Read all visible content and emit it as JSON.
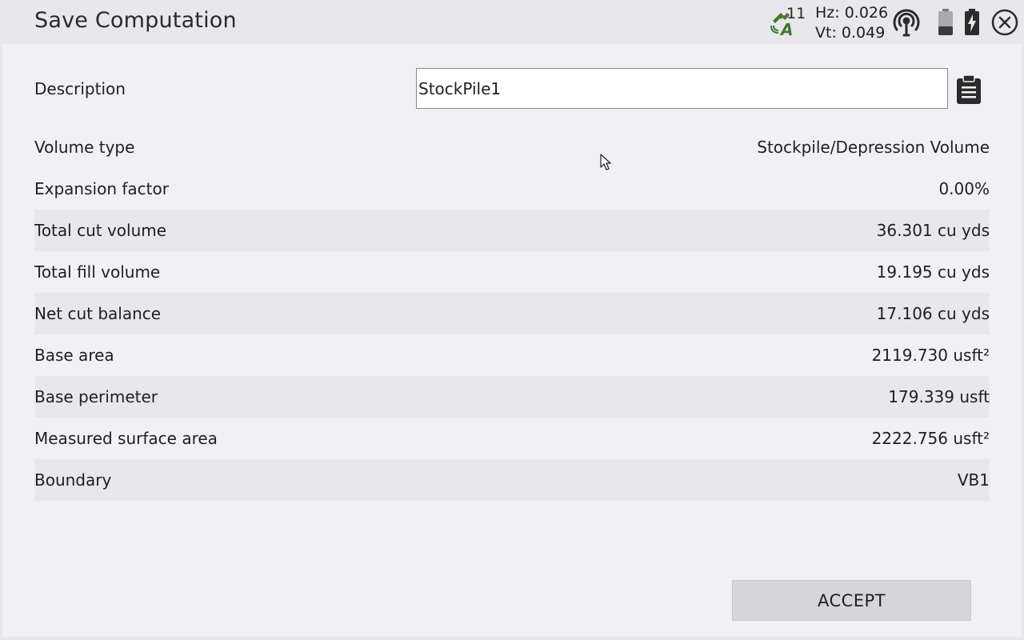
{
  "window": {
    "title": "Save Computation"
  },
  "status": {
    "satellite_icon": "satellite-rtk-icon",
    "satellite_count": "11",
    "hz_precision": "Hz: 0.026",
    "vt_precision": "Vt: 0.049",
    "radio_icon": "radio-signal-icon",
    "battery1_icon": "battery-low-icon",
    "battery2_icon": "battery-charging-icon",
    "close_icon": "close-circle-icon"
  },
  "form": {
    "description_label": "Description",
    "description_value": "StockPile1",
    "clipboard_icon": "clipboard-icon"
  },
  "results": [
    {
      "label": "Volume type",
      "value": "Stockpile/Depression Volume"
    },
    {
      "label": "Expansion factor",
      "value": "0.00%"
    },
    {
      "label": "Total cut volume",
      "value": "36.301 cu yds"
    },
    {
      "label": "Total fill volume",
      "value": "19.195 cu yds"
    },
    {
      "label": "Net cut balance",
      "value": "17.106 cu yds"
    },
    {
      "label": "Base area",
      "value": "2119.730 usft²"
    },
    {
      "label": "Base perimeter",
      "value": "179.339 usft"
    },
    {
      "label": "Measured surface area",
      "value": "2222.756 usft²"
    },
    {
      "label": "Boundary",
      "value": "VB1"
    }
  ],
  "actions": {
    "accept_label": "ACCEPT"
  },
  "colors": {
    "background": "#e8e7ec",
    "panel": "#f1f1f5",
    "row_shade": "#e7e7ec",
    "button": "#d5d5da",
    "satellite_green": "#3f7a2b"
  }
}
